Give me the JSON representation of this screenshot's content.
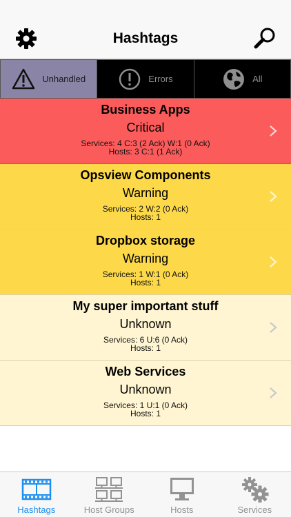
{
  "navbar": {
    "title": "Hashtags",
    "left_icon": "gear-icon",
    "right_icon": "search-icon"
  },
  "filters": [
    {
      "label": "Unhandled",
      "icon": "warning-triangle-icon",
      "active": true
    },
    {
      "label": "Errors",
      "icon": "exclamation-circle-icon",
      "active": false
    },
    {
      "label": "All",
      "icon": "globe-icon",
      "active": false
    }
  ],
  "hashtags": [
    {
      "name": "Business Apps",
      "state": "Critical",
      "services": "Services: 4 C:3 (2 Ack) W:1 (0 Ack)",
      "hosts": "Hosts: 3 C:1 (1 Ack)"
    },
    {
      "name": "Opsview Components",
      "state": "Warning",
      "services": "Services: 2 W:2 (0 Ack)",
      "hosts": "Hosts: 1"
    },
    {
      "name": "Dropbox storage",
      "state": "Warning",
      "services": "Services: 1 W:1 (0 Ack)",
      "hosts": "Hosts: 1"
    },
    {
      "name": "My super important stuff",
      "state": "Unknown",
      "services": "Services: 6 U:6 (0 Ack)",
      "hosts": "Hosts: 1"
    },
    {
      "name": "Web Services",
      "state": "Unknown",
      "services": "Services: 1 U:1 (0 Ack)",
      "hosts": "Hosts: 1"
    }
  ],
  "colors": {
    "critical": "#fc5b5b",
    "warning": "#fdd94a",
    "unknown": "#fff5d2",
    "active_tab": "#1c8ff0",
    "active_filter": "#8a85a6"
  },
  "tabs": [
    {
      "label": "Hashtags",
      "icon": "film-strip-icon",
      "active": true
    },
    {
      "label": "Host Groups",
      "icon": "host-groups-icon",
      "active": false
    },
    {
      "label": "Hosts",
      "icon": "monitor-icon",
      "active": false
    },
    {
      "label": "Services",
      "icon": "gears-icon",
      "active": false
    }
  ]
}
